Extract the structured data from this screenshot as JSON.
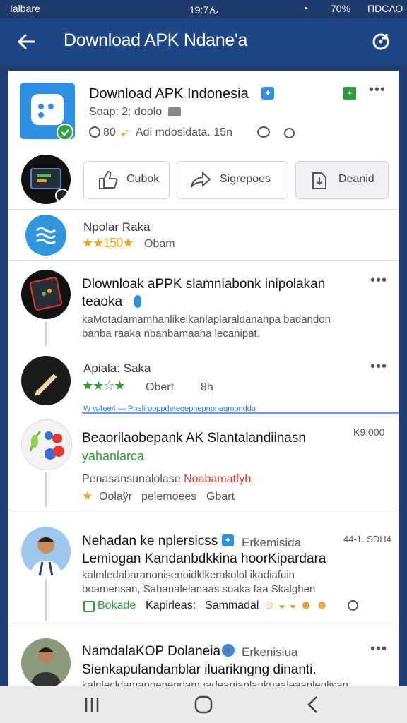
{
  "status_bar": {
    "left": "Ialbare",
    "time": "19:7ん",
    "battery": "70%",
    "right": "ΠDCΛΟ"
  },
  "app_bar": {
    "title": "Download APK Ndane'a"
  },
  "header_card": {
    "title": "Download APK Indonesia",
    "subtitle": "Soap: 2: doolo",
    "meta_left": "80",
    "meta_text": "Adi mdosidata. 15n",
    "actions": [
      "Cubok",
      "Sigrepoes",
      "Deanid"
    ]
  },
  "feed": [
    {
      "title": "Npolar Raka",
      "stars_text": "★★150★",
      "extra": "Obam"
    },
    {
      "title": "Dlownloak aPPK slamniabonk inipolakan",
      "title2": "teaoka",
      "desc": "kaMotadamamhanlikelkanlaplaraldanahpa badandon",
      "desc2": "banba raaka nbanbamaaha lecanipat."
    },
    {
      "title": "Apiala: Saka",
      "extra1": "Obert",
      "extra2": "8h"
    },
    {
      "banner": "W w4ee4 — Pneliropppdeteqepnepnpneqmonddu"
    },
    {
      "title": "Beaorilaobepank AK Slantalandiinasn",
      "title2": "yahanlarca",
      "time": "K9:000",
      "desc_a": "Penasansunalolase ",
      "desc_b": "Noabamatfyb",
      "stat1": "Oolaÿr",
      "stat2": "pelemoees",
      "stat3": "Gbart"
    },
    {
      "title": "Nehadan ke nplersicss",
      "tag": "Erkemisida",
      "time": "44-1. SDH4",
      "title2": "Lemiogan Kandanbdkkina hoorKipardara",
      "desc": "kalmledabaranonisenoidklkerakolol ikadiafuin",
      "desc2": "boamensan, Sahanalelanaas soaka faa Skalghen",
      "stat1": "Bokade",
      "stat2": "Kapirleas:",
      "stat3": "Sammadal"
    },
    {
      "title": "NamdalaKOP Dolaneia",
      "tag": "Erkenisiua",
      "title2": "Sienkapulandanblar iluarikngng dinanti.",
      "desc": "kalnlecldamanoenendamuadeaniaplankuaaleaanleolisan"
    }
  ],
  "colors": {
    "appbar": "#1f4684",
    "accent_blue": "#2f8fe0",
    "star": "#f5a623",
    "green": "#2e9d3a",
    "red": "#e23a2e"
  }
}
